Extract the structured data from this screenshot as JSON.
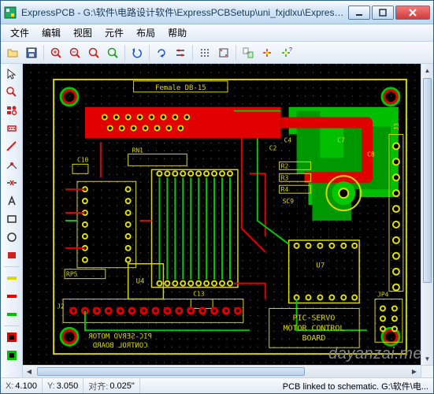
{
  "window": {
    "title": "ExpressPCB - G:\\软件\\电路设计软件\\ExpressPCBSetup\\uni_fxjdlxu\\ExpressPCB..."
  },
  "menu": {
    "file": "文件",
    "edit": "编辑",
    "view": "视图",
    "component": "元件",
    "layout": "布局",
    "help": "帮助"
  },
  "board": {
    "connector_label": "Female DB-15",
    "silk_text_main_1": "PIC-SERVO",
    "silk_text_main_2": "MOTOR CONTROL",
    "silk_text_main_3": "BOARD",
    "silk_text_mirror_1": "PIC-SERVO MOTOR",
    "silk_text_mirror_2": "CONTROL BOARD",
    "refs": {
      "c10": "C10",
      "c13": "C13",
      "c2": "C2",
      "c4": "C4",
      "c7": "C7",
      "c8": "C8",
      "r2": "R2",
      "r3": "R3",
      "r4": "R4",
      "rn1": "RN1",
      "rp5": "RP5",
      "u4": "U4",
      "u7": "U7",
      "j2": "J2",
      "j3": "J3",
      "jp4": "JP4",
      "sc9": "SC9"
    }
  },
  "watermark": "dayanzai.me",
  "status": {
    "x_label": "X:",
    "x_value": "4.100",
    "y_label": "Y:",
    "y_value": "3.050",
    "snap_label": "对齐:",
    "snap_value": "0.025\"",
    "message": "PCB linked to schematic. G:\\软件\\电..."
  },
  "colors": {
    "layer_top": "#e00000",
    "layer_bottom": "#00c800",
    "silk": "#d8d800",
    "board_outline": "#d8d800",
    "pad": "#e0e000",
    "bg": "#000000"
  }
}
